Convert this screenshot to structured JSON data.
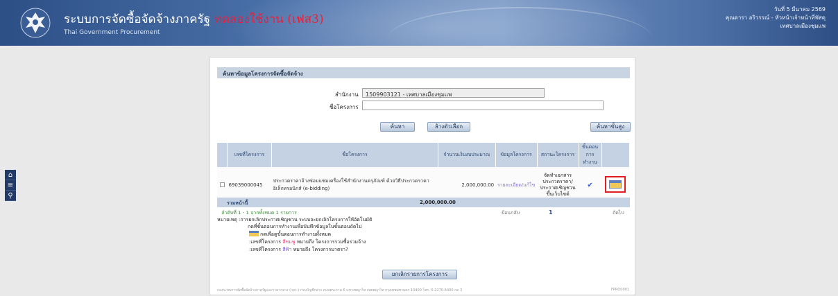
{
  "header": {
    "title": "ระบบการจัดซื้อจัดจ้างภาครัฐ",
    "test_label": "ทดลองใช้งาน (เฟส3)",
    "subtitle": "Thai Government Procurement",
    "date": "วันที่ 5 มีนาคม 2569",
    "user": "คุณดารา อริวรรณ์ - หัวหน้าเจ้าหน้าที่พัสดุ",
    "org": "เทศบาลเมืองชุมแพ"
  },
  "side_tools": [
    "home-icon",
    "menu-icon",
    "search-icon"
  ],
  "panel": {
    "heading": "ค้นหาข้อมูลโครงการจัดซื้อจัดจ้าง",
    "agency_label": "สำนักงาน",
    "agency_value": "1509903121 - เทศบาลเมืองชุมแพ",
    "project_label": "ชื่อโครงการ",
    "project_value": "",
    "buttons": {
      "search": "ค้นหา",
      "clear": "ล้างตัวเลือก",
      "advanced": "ค้นหาขั้นสูง",
      "cancel_projects": "ยกเลิกรายการโครงการ"
    }
  },
  "table": {
    "headers": [
      "เลขที่โครงการ",
      "ชื่อโครงการ",
      "จำนวนเงินงบประมาณ",
      "ข้อมูลโครงการ",
      "สถานะโครงการ",
      "ขั้นตอนการทำงาน"
    ],
    "rows": [
      {
        "project_no": "69039000045",
        "name": "ประกวดราคาจ้างซ่อมแซมเครื่องใช้สำนักงานครุภัณฑ์ ด้วยวิธีประกวดราคาอิเล็กทรอนิกส์ (e-bidding)",
        "budget": "2,000,000.00",
        "info_link": "รายละเอียด/แก้ไข",
        "status": "จัดทำเอกสารประกวดราคา/ประกาศเชิญชวนขึ้นเว็บไซต์"
      }
    ],
    "total_label": "รวมหน้านี้",
    "total_value": "2,000,000.00"
  },
  "pagination": {
    "summary": "ลำดับที่ 1 - 1 จากทั้งหมด 1 รายการ",
    "prev": "ย้อนกลับ",
    "page": "1",
    "next": "ถัดไป"
  },
  "notes": {
    "line1": "หมายเหตุ :การยกเลิกประกาศเชิญชวน ระบบจะยกเลิกโครงการให้อัตโนมัติ",
    "line2": "กดที่ขั้นตอนการทำงานเพื่อบันทึกข้อมูลในขั้นตอนถัดไป",
    "line3": "กดเพื่อดูขั้นตอนการทำงานทั้งหมด",
    "line4_prefix": ":เลขที่โครงการ",
    "line4_color": "สีชมพู",
    "line4_suffix": "หมายถึง โครงการรวมซื้อรวมจ้าง",
    "line5_prefix": ":เลขที่โครงการ",
    "line5_color": "สีฟ้า",
    "line5_suffix": "หมายถึง โครงการมาตรา?"
  },
  "footer": {
    "text": "กองระบบการจัดซื้อจัดจ้างภาครัฐและราคากลาง (กจร.) กรมบัญชีกลาง ถนนพระราม 6 แขวงพญาไท เขตพญาไท กรุงเทพมหานคร 10400 โทร. 0-2270-6400 กด 3",
    "code": "FPRO0001"
  }
}
